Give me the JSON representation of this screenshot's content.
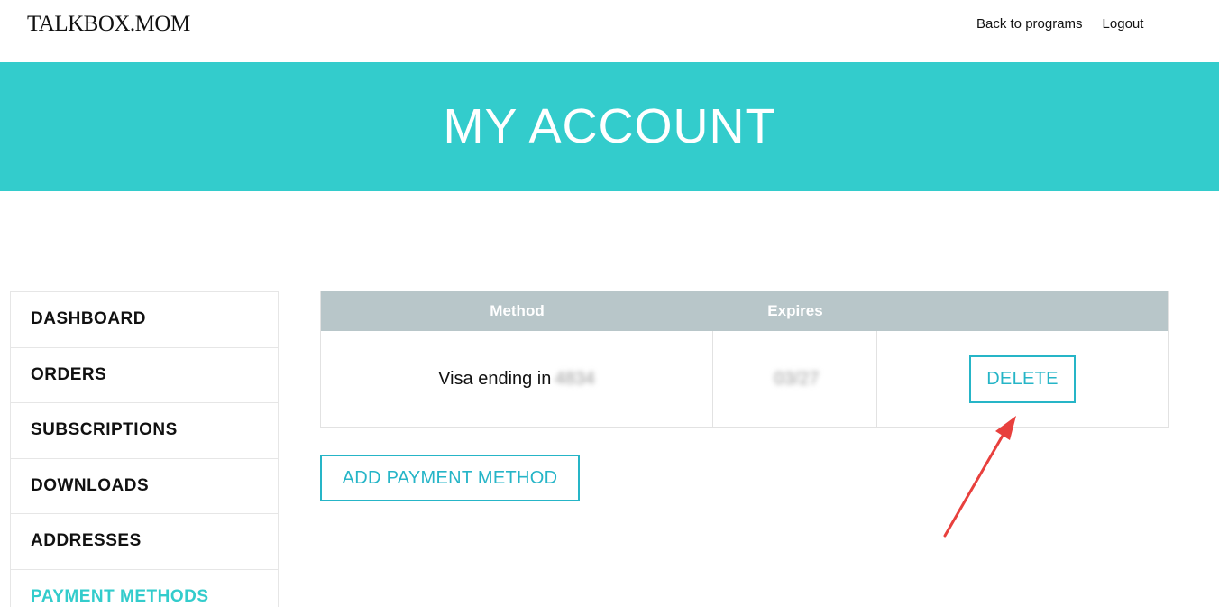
{
  "header": {
    "logo": "TALKBOX.MOM",
    "nav": {
      "back_label": "Back to programs",
      "logout_label": "Logout"
    }
  },
  "hero": {
    "title": "MY ACCOUNT"
  },
  "sidebar": {
    "items": [
      {
        "label": "DASHBOARD",
        "active": false
      },
      {
        "label": "ORDERS",
        "active": false
      },
      {
        "label": "SUBSCRIPTIONS",
        "active": false
      },
      {
        "label": "DOWNLOADS",
        "active": false
      },
      {
        "label": "ADDRESSES",
        "active": false
      },
      {
        "label": "PAYMENT METHODS",
        "active": true
      }
    ]
  },
  "payment_table": {
    "columns": [
      "Method",
      "Expires",
      ""
    ],
    "rows": [
      {
        "method_prefix": "Visa ending in",
        "method_last4": "4834",
        "expires": "03/27",
        "action_label": "DELETE"
      }
    ]
  },
  "add_button_label": "ADD PAYMENT METHOD",
  "colors": {
    "accent": "#33cccc",
    "button_border": "#26b5c7",
    "table_header": "#b8c6c9",
    "annotation_arrow": "#e8403d"
  }
}
